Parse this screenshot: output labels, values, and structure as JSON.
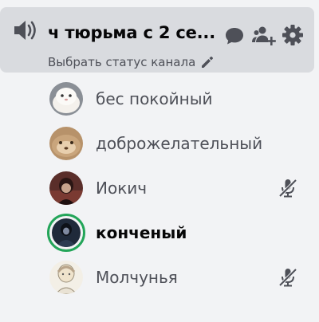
{
  "channel": {
    "name": "ч тюрьма с 2 се...",
    "status_prompt": "Выбрать статус канала",
    "icons": {
      "type": "speaker-icon",
      "chat": "chat-bubble-icon",
      "invite": "invite-people-icon",
      "settings": "gear-icon",
      "edit_status": "pencil-icon"
    }
  },
  "users": [
    {
      "name": "бес покойный",
      "avatar": "white-cat-avatar",
      "muted": false,
      "speaking": false
    },
    {
      "name": "доброжелательный",
      "avatar": "brown-animal-avatar",
      "muted": false,
      "speaking": false
    },
    {
      "name": "Иокич",
      "avatar": "dark-red-character-avatar",
      "muted": true,
      "speaking": false
    },
    {
      "name": "конченый",
      "avatar": "dark-figure-avatar",
      "muted": false,
      "speaking": true
    },
    {
      "name": "Молчунья",
      "avatar": "sketch-drawing-avatar",
      "muted": true,
      "speaking": false
    }
  ],
  "colors": {
    "background": "#f2f3f5",
    "channel_card": "#d9dbdf",
    "speaking_ring": "#23a559",
    "icon": "#4e5058",
    "text_primary": "#060607",
    "text_muted": "#4e5058"
  }
}
